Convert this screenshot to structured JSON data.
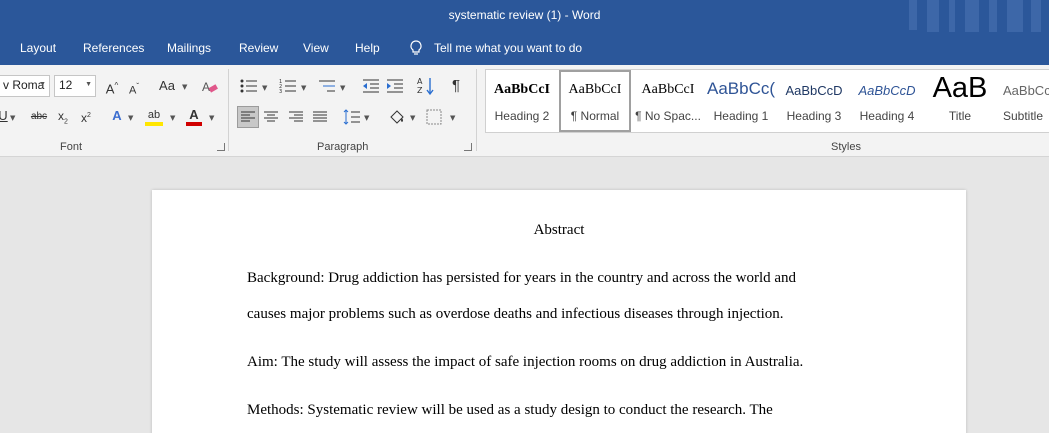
{
  "window": {
    "title": "systematic review (1)  -  Word"
  },
  "menu": {
    "items": [
      "Layout",
      "References",
      "Mailings",
      "Review",
      "View",
      "Help"
    ],
    "tell_me": "Tell me what you want to do"
  },
  "font_group": {
    "font_name": "v Roma",
    "font_size": "12",
    "label": "Font"
  },
  "paragraph_group": {
    "label": "Paragraph"
  },
  "styles_group": {
    "label": "Styles",
    "tiles": [
      {
        "preview": "AaBbCcI",
        "name": "Heading 2"
      },
      {
        "preview": "AaBbCcI",
        "name": "¶ Normal"
      },
      {
        "preview": "AaBbCcI",
        "name": "¶ No Spac..."
      },
      {
        "preview": "AaBbCc(",
        "name": "Heading 1"
      },
      {
        "preview": "AaBbCcD",
        "name": "Heading 3"
      },
      {
        "preview": "AaBbCcD",
        "name": "Heading 4"
      },
      {
        "preview": "AaB",
        "name": "Title"
      },
      {
        "preview": "AaBbCcD",
        "name": "Subtitle"
      }
    ]
  },
  "document": {
    "heading": "Abstract",
    "lines": [
      "Background: Drug addiction has persisted for years in the country and across the world and",
      "causes major problems such as overdose deaths and infectious diseases through injection.",
      "Aim: The study will assess the impact of safe injection rooms on drug addiction in Australia.",
      "Methods: Systematic review will be used as a study design to conduct the research. The"
    ]
  },
  "colors": {
    "title_bar": "#2b579a",
    "ribbon": "#f3f3f3",
    "canvas": "#e6e6e6",
    "highlight_yellow": "#ffe600",
    "font_red": "#d00000"
  }
}
